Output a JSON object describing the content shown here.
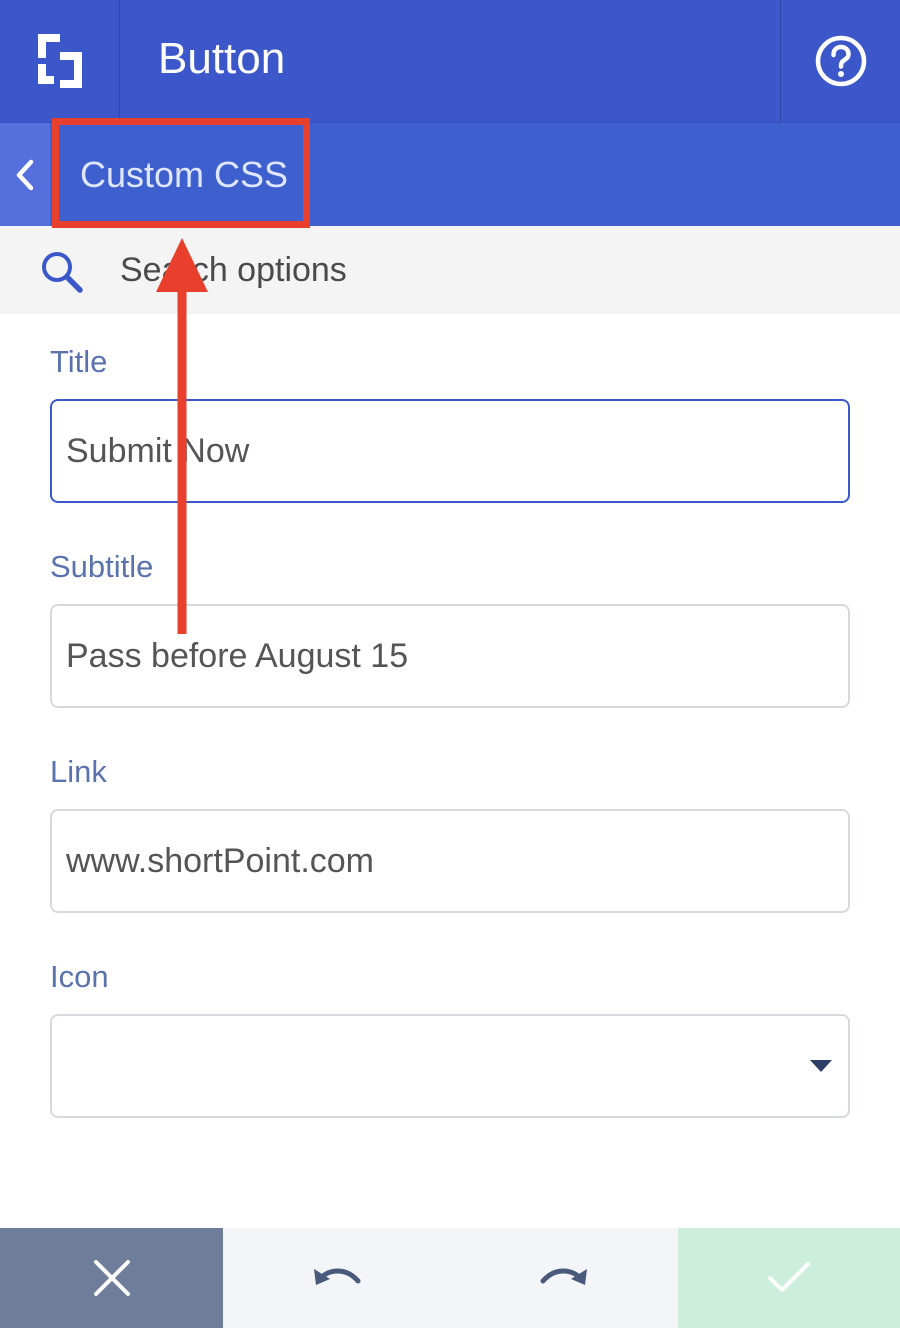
{
  "header": {
    "title": "Button",
    "logo_icon": "shortpoint-logo-icon",
    "help_icon": "help-circle-icon"
  },
  "subheader": {
    "back_icon": "chevron-left-icon",
    "label": "Custom CSS"
  },
  "search": {
    "icon": "search-icon",
    "placeholder": "Search options"
  },
  "form": {
    "title": {
      "label": "Title",
      "value": "Submit Now"
    },
    "subtitle": {
      "label": "Subtitle",
      "value": "Pass before August 15"
    },
    "link": {
      "label": "Link",
      "value": "www.shortPoint.com"
    },
    "icon": {
      "label": "Icon",
      "value": ""
    }
  },
  "footer": {
    "cancel_icon": "close-icon",
    "undo_icon": "undo-icon",
    "redo_icon": "redo-icon",
    "confirm_icon": "check-icon"
  },
  "colors": {
    "header": "#3b57c9",
    "subheader": "#3e5fce",
    "label": "#5b73ad",
    "annotation": "#e8402c",
    "cancel": "#6e7d9a",
    "confirm": "#cdeedd"
  }
}
